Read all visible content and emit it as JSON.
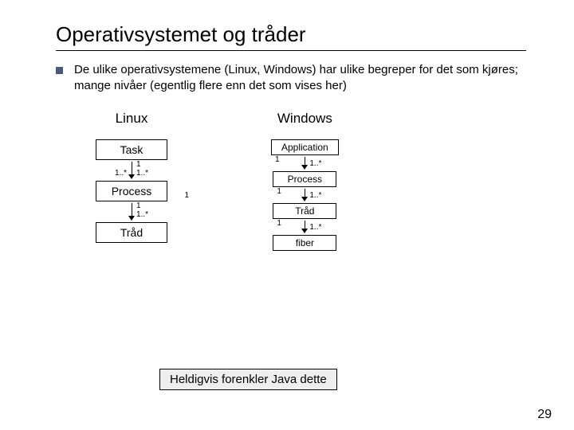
{
  "title": "Operativsystemet og tråder",
  "bullet": "De ulike operativsystemene (Linux, Windows) har ulike begreper for det som kjøres; mange nivåer (egentlig flere enn det som vises her)",
  "linux": {
    "heading": "Linux",
    "task": "Task",
    "process": "Process",
    "thread": "Tråd",
    "m1": "1",
    "m1s": "1..*",
    "self": "1..*"
  },
  "windows": {
    "heading": "Windows",
    "app": "Application",
    "process": "Process",
    "thread": "Tråd",
    "fiber": "fiber",
    "m1": "1",
    "m1s": "1..*"
  },
  "footnote": "Heldigvis forenkler Java dette",
  "page": "29"
}
